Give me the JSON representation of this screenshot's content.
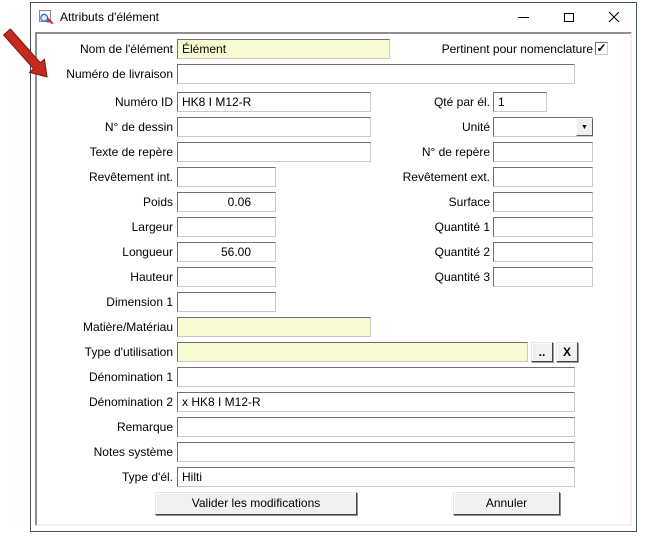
{
  "window": {
    "title": "Attributs d'élément",
    "controls": {
      "minimize": "minimize-icon",
      "maximize": "maximize-icon",
      "close": "close-icon"
    }
  },
  "icons": {
    "checkmark": "✓",
    "dropdown_arrow": "▼"
  },
  "annotation": {
    "shape": "red-arrow",
    "color": "#C42A1E"
  },
  "colors": {
    "highlight_field": "#FAFAD2",
    "window_border": "#45535A"
  },
  "fields": {
    "nom": {
      "label": "Nom de l'élément",
      "value": "Élément"
    },
    "pertinent": {
      "label": "Pertinent pour nomenclature",
      "checked": true
    },
    "livraison": {
      "label": "Numéro de livraison",
      "value": ""
    },
    "numero_id": {
      "label": "Numéro ID",
      "value": "HK8 I M12-R"
    },
    "qte_par_el": {
      "label": "Qté par él.",
      "value": "1"
    },
    "dessin": {
      "label": "N° de dessin",
      "value": ""
    },
    "unite": {
      "label": "Unité",
      "value": ""
    },
    "texte_repere": {
      "label": "Texte de repère",
      "value": ""
    },
    "n_repere": {
      "label": "N° de repère",
      "value": ""
    },
    "revetement_int": {
      "label": "Revêtement int.",
      "value": ""
    },
    "revetement_ext": {
      "label": "Revêtement ext.",
      "value": ""
    },
    "poids": {
      "label": "Poids",
      "value": "0.06"
    },
    "surface": {
      "label": "Surface",
      "value": ""
    },
    "largeur": {
      "label": "Largeur",
      "value": ""
    },
    "quantite1": {
      "label": "Quantité 1",
      "value": ""
    },
    "longueur": {
      "label": "Longueur",
      "value": "56.00"
    },
    "quantite2": {
      "label": "Quantité 2",
      "value": ""
    },
    "hauteur": {
      "label": "Hauteur",
      "value": ""
    },
    "quantite3": {
      "label": "Quantité 3",
      "value": ""
    },
    "dimension1": {
      "label": "Dimension 1",
      "value": ""
    },
    "matiere": {
      "label": "Matière/Matériau",
      "value": ""
    },
    "type_utilisation": {
      "label": "Type d'utilisation",
      "value": "",
      "browse_label": "..",
      "clear_label": "X"
    },
    "denomination1": {
      "label": "Dénomination 1",
      "value": ""
    },
    "denomination2": {
      "label": "Dénomination 2",
      "value": "x HK8 I M12-R"
    },
    "remarque": {
      "label": "Remarque",
      "value": ""
    },
    "notes_systeme": {
      "label": "Notes système",
      "value": ""
    },
    "type_el": {
      "label": "Type d'él.",
      "value": "Hilti"
    }
  },
  "buttons": {
    "validate": "Valider les modifications",
    "cancel": "Annuler"
  }
}
